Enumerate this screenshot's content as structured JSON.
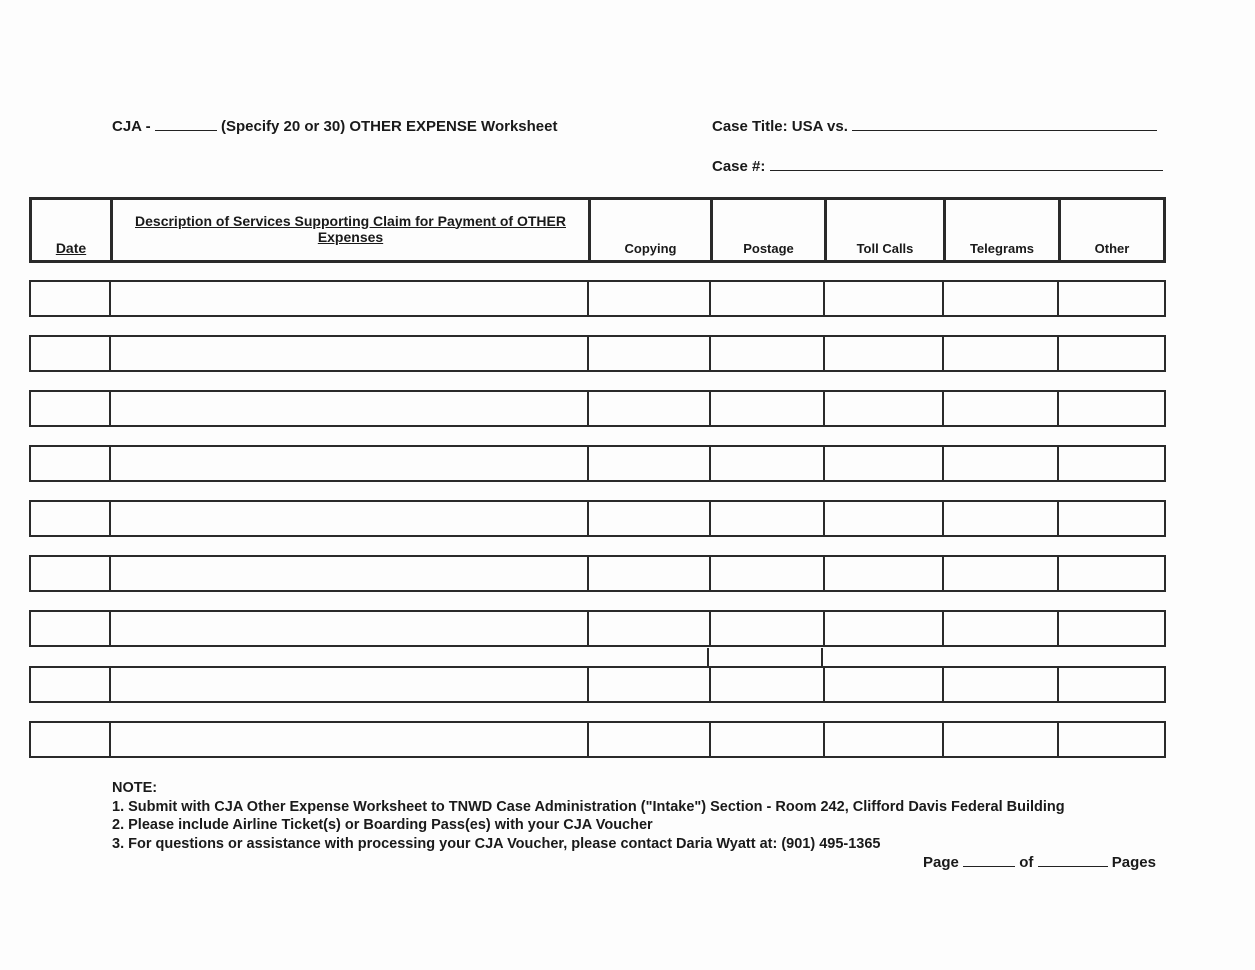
{
  "form": {
    "title_prefix": "CJA -",
    "title_suffix": "(Specify 20 or 30) OTHER EXPENSE Worksheet",
    "case_title_label": "Case Title: USA vs.",
    "case_number_label": "Case #:"
  },
  "table": {
    "columns": [
      {
        "key": "date",
        "label": "Date",
        "underlined": true
      },
      {
        "key": "description",
        "label_line1": "Description of Services Supporting Claim for Payment of OTHER",
        "label_line2": "Expenses",
        "underlined": true
      },
      {
        "key": "copying",
        "label": "Copying"
      },
      {
        "key": "postage",
        "label": "Postage"
      },
      {
        "key": "toll_calls",
        "label": "Toll Calls"
      },
      {
        "key": "telegrams",
        "label": "Telegrams"
      },
      {
        "key": "other",
        "label": "Other"
      }
    ],
    "row_count": 9,
    "rows": [
      {
        "date": "",
        "description": "",
        "copying": "",
        "postage": "",
        "toll_calls": "",
        "telegrams": "",
        "other": ""
      },
      {
        "date": "",
        "description": "",
        "copying": "",
        "postage": "",
        "toll_calls": "",
        "telegrams": "",
        "other": ""
      },
      {
        "date": "",
        "description": "",
        "copying": "",
        "postage": "",
        "toll_calls": "",
        "telegrams": "",
        "other": ""
      },
      {
        "date": "",
        "description": "",
        "copying": "",
        "postage": "",
        "toll_calls": "",
        "telegrams": "",
        "other": ""
      },
      {
        "date": "",
        "description": "",
        "copying": "",
        "postage": "",
        "toll_calls": "",
        "telegrams": "",
        "other": ""
      },
      {
        "date": "",
        "description": "",
        "copying": "",
        "postage": "",
        "toll_calls": "",
        "telegrams": "",
        "other": ""
      },
      {
        "date": "",
        "description": "",
        "copying": "",
        "postage": "",
        "toll_calls": "",
        "telegrams": "",
        "other": ""
      },
      {
        "date": "",
        "description": "",
        "copying": "",
        "postage": "",
        "toll_calls": "",
        "telegrams": "",
        "other": ""
      },
      {
        "date": "",
        "description": "",
        "copying": "",
        "postage": "",
        "toll_calls": "",
        "telegrams": "",
        "other": ""
      }
    ]
  },
  "notes": {
    "heading": "NOTE:",
    "items": [
      "1. Submit with CJA Other Expense Worksheet to TNWD Case Administration (\"Intake\") Section - Room 242, Clifford Davis Federal Building",
      "2. Please include Airline Ticket(s) or Boarding Pass(es) with your CJA Voucher",
      "3. For questions or assistance with processing your CJA Voucher, please contact Daria Wyatt at: (901) 495-1365"
    ]
  },
  "pagination": {
    "page_label": "Page",
    "of_label": "of",
    "pages_label": "Pages"
  }
}
